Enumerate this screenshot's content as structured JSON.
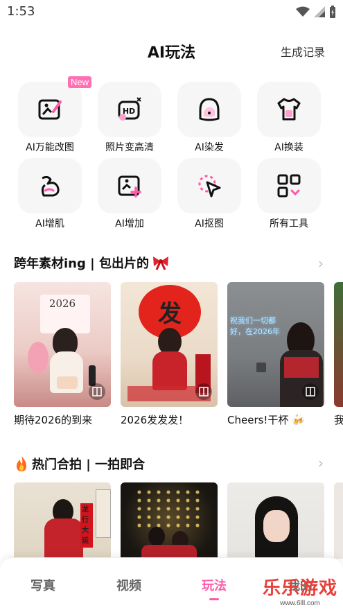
{
  "status": {
    "time": "1:53"
  },
  "header": {
    "title": "AI玩法",
    "history": "生成记录"
  },
  "tools": [
    {
      "label": "AI万能改图",
      "badge": "New",
      "icon": "ai-edit-icon"
    },
    {
      "label": "照片变高清",
      "icon": "hd-icon"
    },
    {
      "label": "AI染发",
      "icon": "hair-dye-icon"
    },
    {
      "label": "AI换装",
      "icon": "outfit-icon"
    },
    {
      "label": "AI增肌",
      "icon": "muscle-icon"
    },
    {
      "label": "AI增加",
      "icon": "add-image-icon"
    },
    {
      "label": "AI抠图",
      "icon": "cutout-icon"
    },
    {
      "label": "所有工具",
      "icon": "all-tools-icon"
    }
  ],
  "section1": {
    "title": "跨年素材ing | 包出片的",
    "cards": [
      {
        "caption": "期待2026的到来",
        "overlay": "2026"
      },
      {
        "caption": "2026发发发！",
        "overlay": "发"
      },
      {
        "caption": "Cheers!干杯",
        "overlay": "祝我们一切都好，在2026年"
      },
      {
        "caption": "我"
      }
    ]
  },
  "section2": {
    "title": "热门合拍 | 一拍即合",
    "cards": [
      {
        "overlay": "龙行大运"
      },
      {},
      {}
    ]
  },
  "tabs": [
    {
      "label": "写真"
    },
    {
      "label": "视频"
    },
    {
      "label": "玩法"
    },
    {
      "label": "我的"
    }
  ],
  "watermark": {
    "text": "乐乐游戏",
    "url": "www.6lll.com"
  },
  "colors": {
    "accent": "#ff5aa9",
    "tile_bg": "#f6f6f6"
  }
}
